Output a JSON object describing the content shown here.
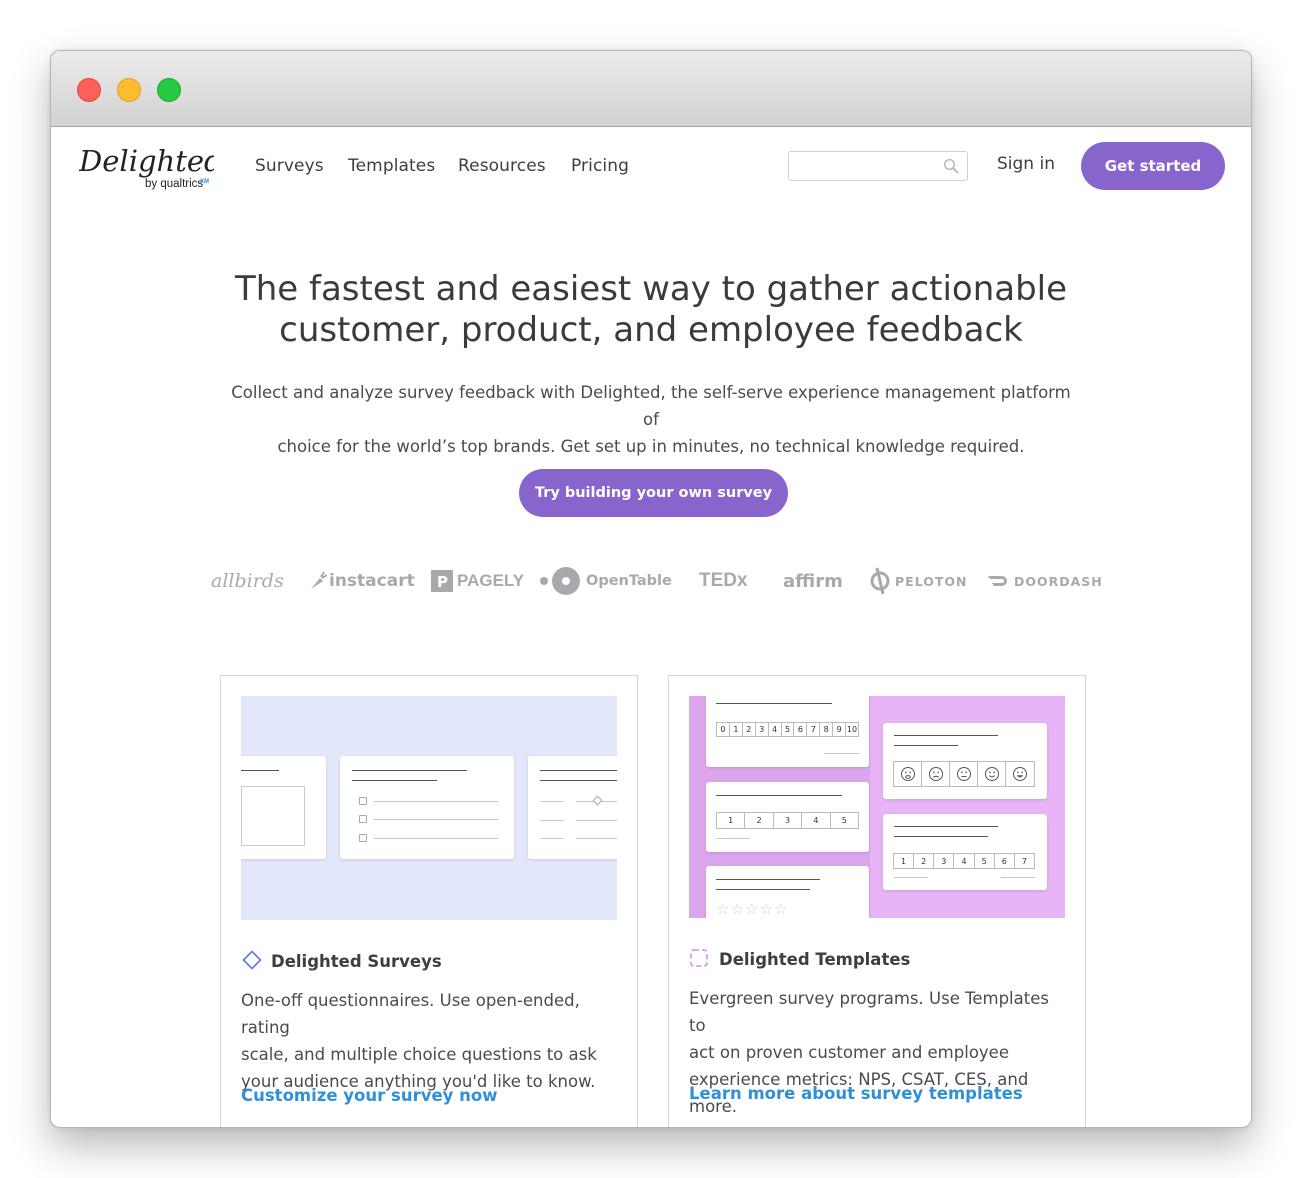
{
  "window": {
    "controls": [
      "close",
      "minimize",
      "maximize"
    ]
  },
  "nav": {
    "logo": {
      "main": "Delighted",
      "sub": "by qualtrics",
      "mark": "XM"
    },
    "links": [
      "Surveys",
      "Templates",
      "Resources",
      "Pricing"
    ],
    "search": {
      "placeholder": "",
      "icon": "search-icon"
    },
    "signin": "Sign in",
    "get_started": "Get started"
  },
  "hero": {
    "title_line1": "The fastest and easiest way to gather actionable",
    "title_line2": "customer, product, and employee feedback",
    "subtitle_line1": "Collect and analyze survey feedback with Delighted, the self-serve experience management platform of",
    "subtitle_line2": "choice for the world’s top brands. Get set up in minutes, no technical knowledge required.",
    "cta": "Try building your own survey"
  },
  "brands": [
    "allbirds",
    "instacart",
    "PAGELY",
    "OpenTable",
    "TEDx",
    "affirm",
    "PELOTON",
    "DOORDASH"
  ],
  "cards": [
    {
      "title": "Delighted Surveys",
      "icon": "diamond-icon",
      "desc": [
        "One-off questionnaires. Use open-ended, rating",
        "scale, and multiple choice questions to ask",
        "your audience anything you'd like to know."
      ],
      "link": "Customize your survey now"
    },
    {
      "title": "Delighted Templates",
      "icon": "dashed-square-icon",
      "desc": [
        "Evergreen survey programs. Use Templates to",
        "act on proven customer and employee",
        "experience metrics: NPS, CSAT, CES, and more."
      ],
      "link": "Learn more about survey templates"
    }
  ],
  "mock_scales": {
    "nps": [
      "0",
      "1",
      "2",
      "3",
      "4",
      "5",
      "6",
      "7",
      "8",
      "9",
      "10"
    ],
    "five": [
      "1",
      "2",
      "3",
      "4",
      "5"
    ],
    "seven": [
      "1",
      "2",
      "3",
      "4",
      "5",
      "6",
      "7"
    ]
  },
  "colors": {
    "accent": "#8765cc",
    "link": "#2f8fd8",
    "surveys_bg": "#e3e7fb",
    "templates_bg": "#e8b4f7"
  }
}
